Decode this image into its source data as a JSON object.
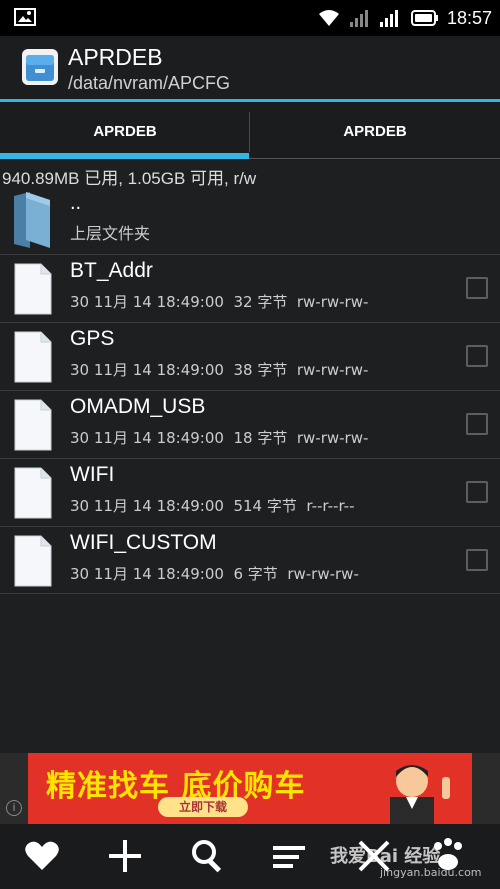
{
  "status_bar": {
    "time": "18:57",
    "icons": [
      "image-icon",
      "wifi-icon",
      "signal-icon",
      "signal-icon",
      "battery-icon"
    ]
  },
  "action_bar": {
    "title": "APRDEB",
    "path": "/data/nvram/APCFG",
    "icon": "file-cabinet-icon"
  },
  "tabs": [
    {
      "label": "APRDEB",
      "active": true
    },
    {
      "label": "APRDEB",
      "active": false
    }
  ],
  "storage_info": "940.89MB 已用, 1.05GB 可用, r/w",
  "parent": {
    "name": "..",
    "label": "上层文件夹"
  },
  "files": [
    {
      "name": "BT_Addr",
      "meta": "30 11月 14 18:49:00  32 字节  rw-rw-rw-"
    },
    {
      "name": "GPS",
      "meta": "30 11月 14 18:49:00  38 字节  rw-rw-rw-"
    },
    {
      "name": "OMADM_USB",
      "meta": "30 11月 14 18:49:00  18 字节  rw-rw-rw-"
    },
    {
      "name": "WIFI",
      "meta": "30 11月 14 18:49:00  514 字节  r--r--r--"
    },
    {
      "name": "WIFI_CUSTOM",
      "meta": "30 11月 14 18:49:00  6 字节  rw-rw-rw-"
    }
  ],
  "ad": {
    "headline": "精准找车 底价购车",
    "button": "立即下载",
    "info": "i"
  },
  "bottom_bar": [
    "heart-icon",
    "plus-icon",
    "search-icon",
    "sort-icon",
    "close-icon",
    "baidu-paw-icon"
  ],
  "watermark": {
    "text": "我爱Bai 经验",
    "url": "jingyan.baidu.com"
  },
  "colors": {
    "accent": "#33b5e5",
    "background": "#1e1f21",
    "ad_red": "#e23227",
    "ad_yellow": "#ffe400"
  }
}
